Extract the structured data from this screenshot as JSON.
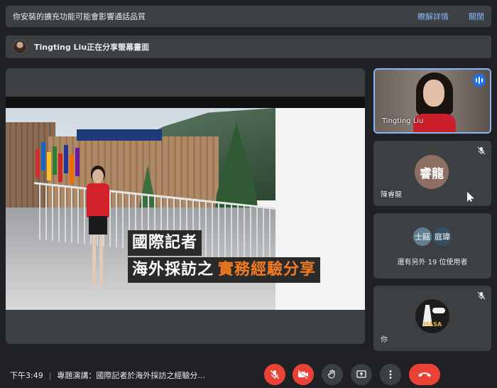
{
  "banner": {
    "message": "你安裝的擴充功能可能會影響通話品質",
    "details_link": "瞭解詳情",
    "close_link": "關閉"
  },
  "presenting": {
    "text": "Tingting Liu正在分享螢幕畫面"
  },
  "slide": {
    "caption_line1": "國際記者",
    "caption_line2_a": "海外採訪之",
    "caption_line2_b": "實務經驗分享"
  },
  "participants": {
    "tile1": {
      "name": "Tingting Liu"
    },
    "tile2": {
      "avatar_initials": "睿龍",
      "name": "陳睿龍"
    },
    "tile3": {
      "avatar_a": "士甌",
      "avatar_b": "庭瑋",
      "others_label": "還有另外 19 位使用者"
    },
    "tile4": {
      "name": "你",
      "logo_text": "MASA"
    }
  },
  "bottom_bar": {
    "time": "下午3:49",
    "meeting_title": "專題演講：國際記者於海外採訪之經驗分..."
  },
  "colors": {
    "accent": "#8ab4f8",
    "danger": "#ea4335",
    "panel": "#3c4043",
    "background": "#1f2124",
    "caption_highlight": "#f47c20"
  },
  "icons": {
    "mic": "mic-off-icon",
    "camera": "camera-off-icon",
    "hand": "raise-hand-icon",
    "present": "present-screen-icon",
    "more": "more-vert-icon",
    "hangup": "hangup-icon"
  }
}
